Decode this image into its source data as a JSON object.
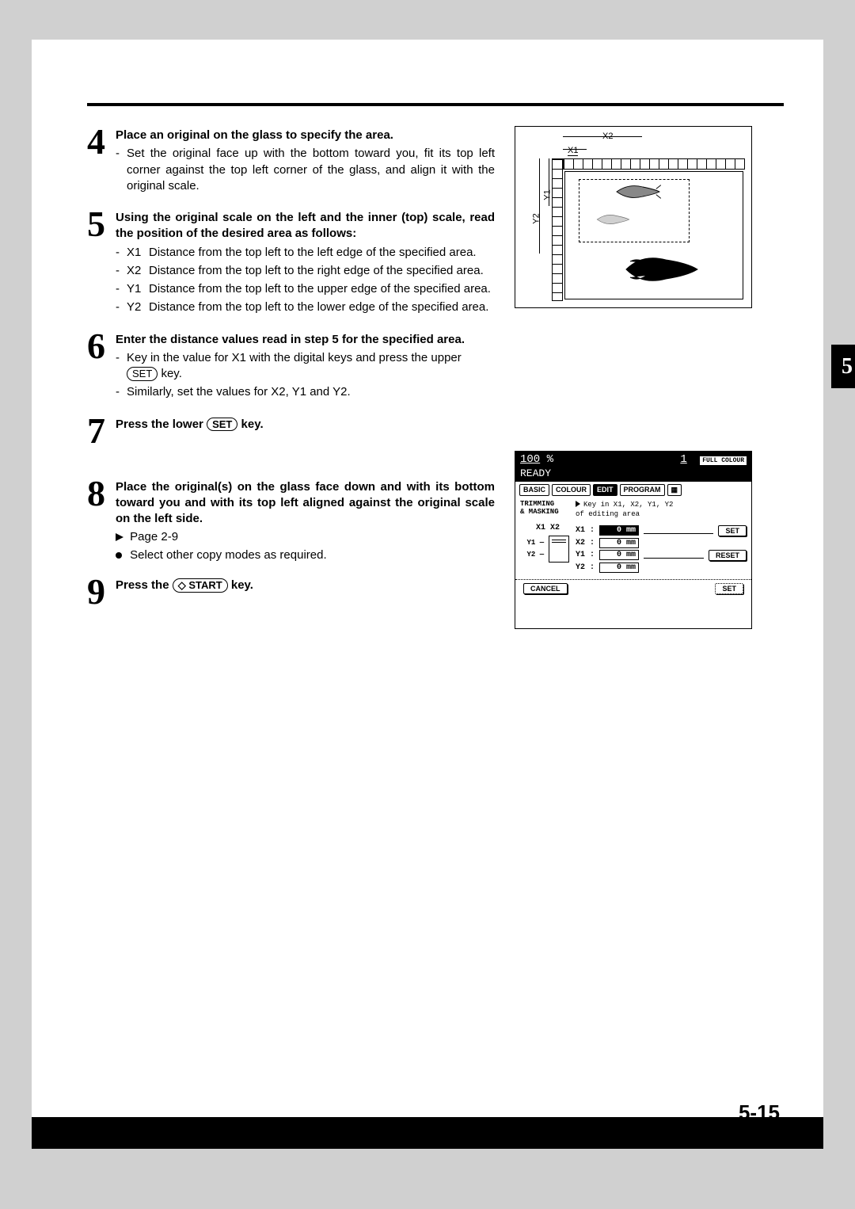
{
  "tab_number": "5",
  "page_number": "5-15",
  "step4": {
    "num": "4",
    "head": "Place an original on the glass to specify the area.",
    "sub1_dash": "-",
    "sub1": "Set the original face up with the bottom toward you, fit its top left corner against the top left corner of the glass, and align it with the original scale."
  },
  "step5": {
    "num": "5",
    "head": "Using the original scale on the left and the inner (top) scale, read the position of the desired area as follows:",
    "rows": [
      {
        "dash": "-",
        "code": "X1",
        "text": "Distance from the top left to the left edge of the specified area."
      },
      {
        "dash": "-",
        "code": "X2",
        "text": "Distance from the top left to the right edge of the specified area."
      },
      {
        "dash": "-",
        "code": "Y1",
        "text": "Distance from the top left to the upper edge of the specified area."
      },
      {
        "dash": "-",
        "code": "Y2",
        "text": "Distance from the top left to the lower edge of the specified area."
      }
    ]
  },
  "step6": {
    "num": "6",
    "head": "Enter the distance values read in step 5 for the specified area.",
    "sub1_dash": "-",
    "sub1a": "Key in the value for X1 with the digital keys and press the upper ",
    "sub1_key": "SET",
    "sub1b": " key.",
    "sub2_dash": "-",
    "sub2": "Similarly, set the values for X2, Y1 and Y2."
  },
  "step7": {
    "num": "7",
    "head_a": "Press the lower ",
    "head_key": "SET",
    "head_b": " key."
  },
  "step8": {
    "num": "8",
    "head": "Place the original(s) on the glass face down and with its bottom toward you and with its top left aligned against the original scale on the left side.",
    "pageref": "Page 2-9",
    "bullet": "Select other copy modes as required."
  },
  "step9": {
    "num": "9",
    "head_a": "Press the ",
    "head_key": "START",
    "head_b": " key."
  },
  "fig1": {
    "x1": "X1",
    "x2": "X2",
    "y1": "Y1",
    "y2": "Y2"
  },
  "lcd": {
    "zoom": "100",
    "pct": "%",
    "count": "1",
    "mode": "FULL COLOUR",
    "status": "READY",
    "tabs": [
      "BASIC",
      "COLOUR",
      "EDIT",
      "PROGRAM"
    ],
    "section": "TRIMMING\n& MASKING",
    "prompt": "Key in X1, X2, Y1, Y2\nof editing area",
    "xheader": "X1 X2",
    "y1": "Y1",
    "y2": "Y2",
    "rows": [
      {
        "label": "X1 :",
        "val": "0",
        "unit": "mm",
        "sel": true
      },
      {
        "label": "X2 :",
        "val": "0",
        "unit": "mm",
        "sel": false
      },
      {
        "label": "Y1 :",
        "val": "0",
        "unit": "mm",
        "sel": false
      },
      {
        "label": "Y2 :",
        "val": "0",
        "unit": "mm",
        "sel": false
      }
    ],
    "btn_set": "SET",
    "btn_reset": "RESET",
    "btn_cancel": "CANCEL",
    "btn_set2": "SET"
  }
}
